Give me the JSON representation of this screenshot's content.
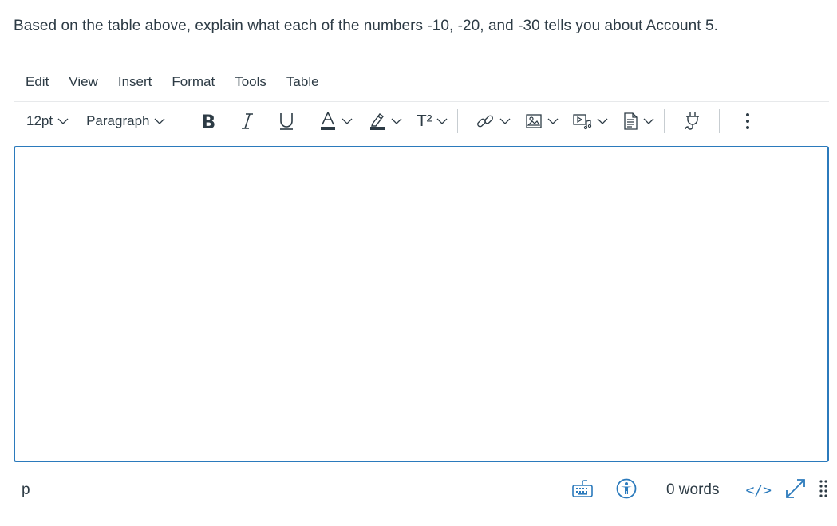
{
  "question": {
    "text": "Based on the table above, explain what each of the numbers -10, -20, and -30 tells you about Account 5."
  },
  "menubar": {
    "items": [
      {
        "label": "Edit"
      },
      {
        "label": "View"
      },
      {
        "label": "Insert"
      },
      {
        "label": "Format"
      },
      {
        "label": "Tools"
      },
      {
        "label": "Table"
      }
    ]
  },
  "toolbar": {
    "font_size": "12pt",
    "block_format": "Paragraph",
    "buttons": [
      {
        "name": "bold",
        "icon": "bold-icon"
      },
      {
        "name": "italic",
        "icon": "italic-icon"
      },
      {
        "name": "underline",
        "icon": "underline-icon"
      },
      {
        "name": "text-color",
        "icon": "text-color-icon",
        "has_menu": true
      },
      {
        "name": "highlight-color",
        "icon": "highlighter-icon",
        "has_menu": true
      },
      {
        "name": "superscript",
        "icon": "superscript-icon",
        "label": "T²",
        "has_menu": true
      },
      {
        "name": "link",
        "icon": "link-icon",
        "has_menu": true
      },
      {
        "name": "image",
        "icon": "image-icon",
        "has_menu": true
      },
      {
        "name": "media",
        "icon": "media-icon",
        "has_menu": true
      },
      {
        "name": "document",
        "icon": "document-icon",
        "has_menu": true
      },
      {
        "name": "apps",
        "icon": "plug-icon"
      },
      {
        "name": "more",
        "icon": "more-vertical-icon"
      }
    ],
    "superscript_label": "T²"
  },
  "editor": {
    "content": ""
  },
  "statusbar": {
    "path": "p",
    "word_count": "0 words",
    "html_toggle_label": "</>"
  },
  "colors": {
    "accent": "#2b7abc",
    "text": "#2d3b45",
    "divider": "#c7cdd1"
  }
}
